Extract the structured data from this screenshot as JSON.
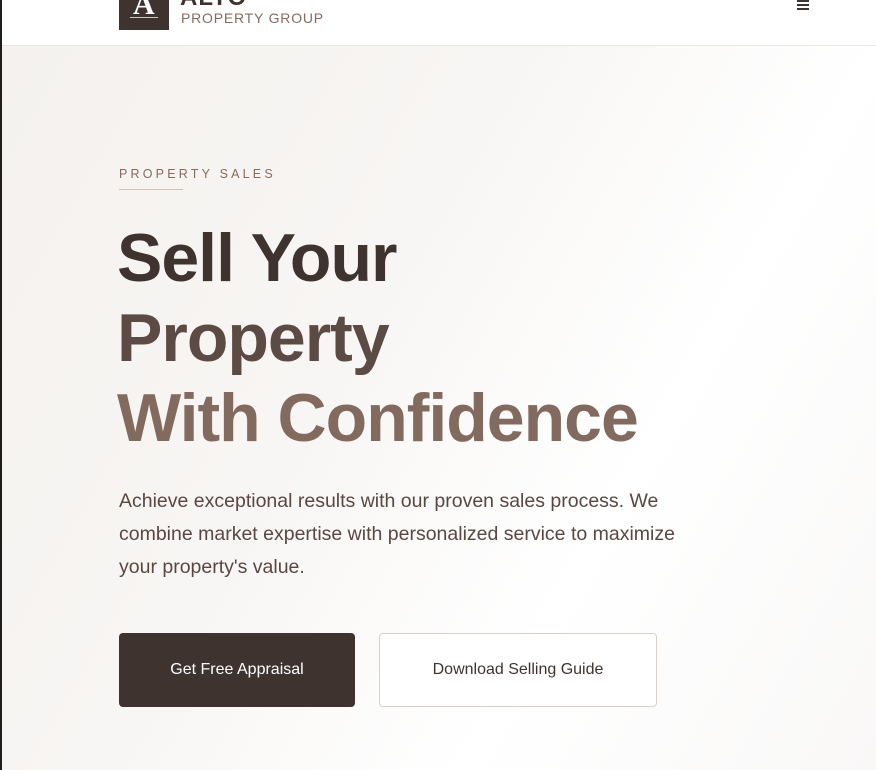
{
  "header": {
    "logo_letter": "A",
    "brand_name": "ALTO",
    "brand_subtitle": "PROPERTY GROUP",
    "menu_icon": "hamburger-menu-icon"
  },
  "hero": {
    "eyebrow": "PROPERTY SALES",
    "headline": {
      "line1": "Sell Your",
      "line2": "Property",
      "line3": "With Confidence"
    },
    "lede": "Achieve exceptional results with our proven sales process. We combine market expertise with personalized service to maximize your property's value.",
    "primary_cta": "Get Free Appraisal",
    "secondary_cta": "Download Selling Guide"
  },
  "colors": {
    "brand_dark": "#3f3330",
    "brand_mid": "#5c4a44",
    "brand_accent": "#836a5f",
    "background": "#f6f3f0"
  }
}
